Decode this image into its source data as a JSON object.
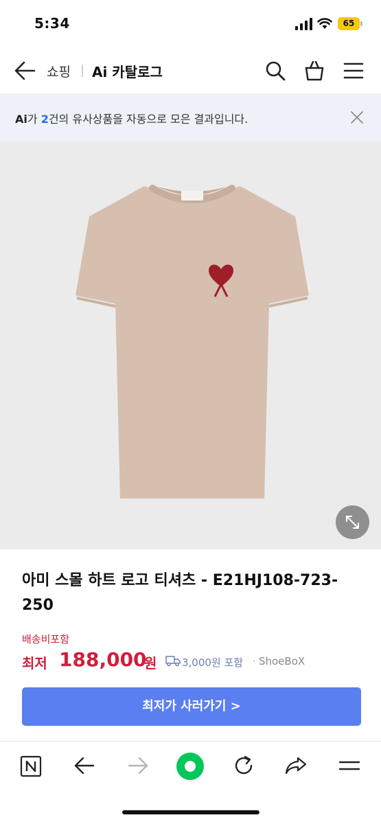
{
  "status_bar": {
    "time": "5:34",
    "battery": "65"
  },
  "nav": {
    "shopping_label": "쇼핑",
    "catalog_title": "Ai 카탈로그"
  },
  "banner": {
    "ai_label": "Ai",
    "prefix": "가 ",
    "count": "2",
    "suffix": "건의 유사상품을 자동으로 모은 결과입니다."
  },
  "product": {
    "title": "아미 스몰 하트 로고 티셔츠 - E21HJ108-723-250",
    "shipping_note": "배송비포함",
    "lowest_label": "최저",
    "price": "188,000",
    "currency": "원",
    "delivery_fee": "3,000원 포함",
    "separator": "·",
    "store": "ShoeBoX",
    "buy_button": "최저가 사러가기 >"
  },
  "colors": {
    "accent_red": "#d01e3c",
    "button_blue": "#5a7ff0",
    "highlight_blue": "#2d6be4",
    "naver_green": "#03c75a",
    "shirt_beige": "#d6bfae"
  },
  "icons": {
    "nav": [
      "back-arrow-icon",
      "search-icon",
      "shopping-bag-icon",
      "hamburger-menu-icon"
    ],
    "banner": [
      "close-icon"
    ],
    "image": [
      "expand-icon"
    ],
    "toolbar": [
      "naver-n-icon",
      "back-arrow-icon",
      "forward-arrow-icon",
      "green-home-icon",
      "reload-icon",
      "share-icon",
      "menu-icon"
    ]
  }
}
